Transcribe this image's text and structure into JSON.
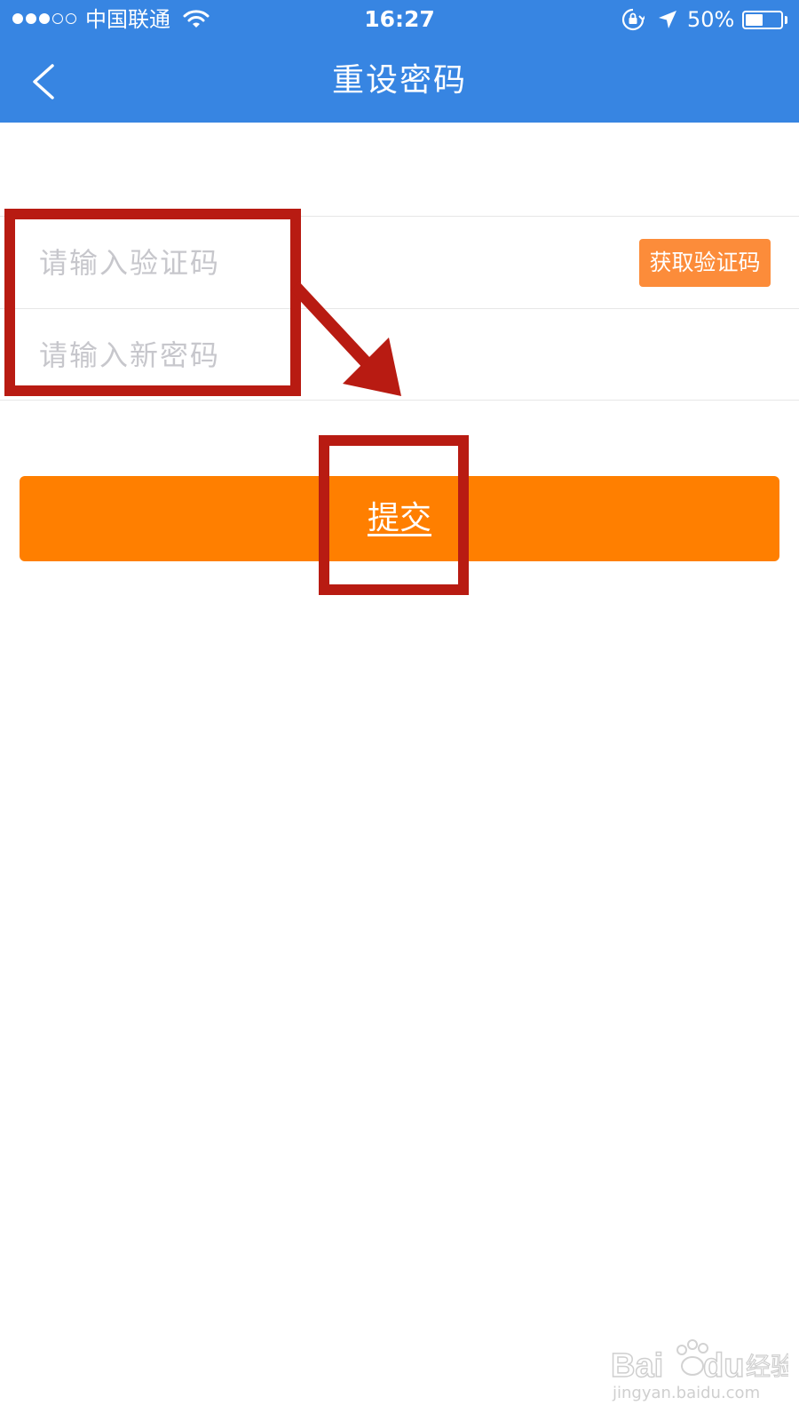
{
  "status_bar": {
    "carrier": "中国联通",
    "time": "16:27",
    "battery_percent": "50%",
    "battery_level": 0.5,
    "signal_bars": 3,
    "signal_total": 5
  },
  "nav": {
    "title": "重设密码"
  },
  "form": {
    "code_placeholder": "请输入验证码",
    "code_value": "",
    "get_code_label": "获取验证码",
    "password_placeholder": "请输入新密码",
    "password_value": ""
  },
  "submit": {
    "label": "提交"
  },
  "watermark": {
    "brand": "Baidu 经验",
    "url": "jingyan.baidu.com"
  },
  "colors": {
    "header_blue": "#3785e2",
    "accent_orange": "#ff7f00",
    "get_code_orange": "#fc8c3a",
    "annotation_red": "#b81b12"
  },
  "icons": [
    "back-arrow-icon",
    "wifi-icon",
    "rotation-lock-icon",
    "location-arrow-icon",
    "battery-icon"
  ]
}
